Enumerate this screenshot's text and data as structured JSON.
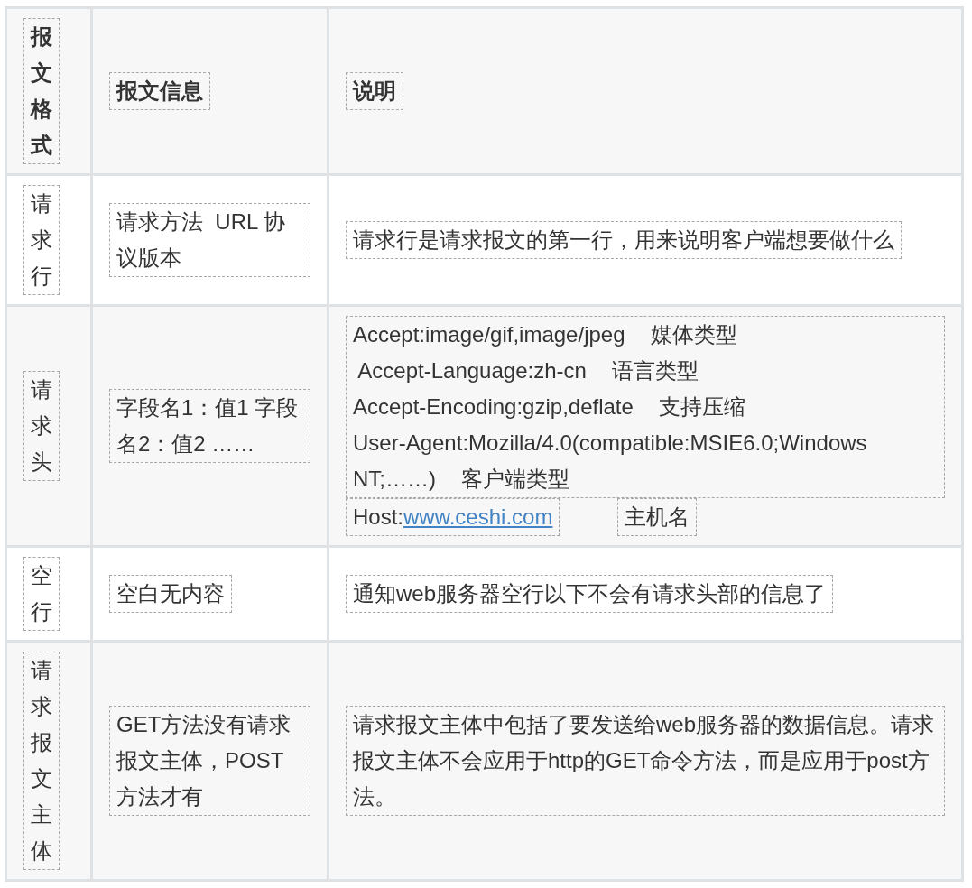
{
  "table": {
    "columns": [
      {
        "text": "报文格式",
        "vertical": true
      },
      {
        "text": "报文信息",
        "vertical": false
      },
      {
        "text": "说明",
        "vertical": false
      }
    ],
    "rows": [
      {
        "label": "请求行",
        "info": "请求方法  URL 协议版本",
        "description": {
          "kind": "text",
          "text": "请求行是请求报文的第一行，用来说明客户端想要做什么"
        }
      },
      {
        "label": "请求头",
        "info": "字段名1：值1 字段名2：值2 ……",
        "description": {
          "kind": "headers",
          "lines": [
            {
              "field": "Accept:image/gif,image/jpeg",
              "note": "媒体类型"
            },
            {
              "field": " Accept-Language:zh-cn",
              "note": "语言类型"
            },
            {
              "field": "Accept-Encoding:gzip,deflate",
              "note": "支持压缩"
            },
            {
              "field": "User-Agent:Mozilla/4.0(compatible:MSIE6.0;Windows"
            },
            {
              "field": "NT;……)",
              "note": "客户端类型"
            }
          ],
          "host": {
            "prefix": "Host:",
            "link": "www.ceshi.com"
          },
          "host_note": "主机名"
        }
      },
      {
        "label": "空行",
        "info": "空白无内容",
        "description": {
          "kind": "text",
          "text": "通知web服务器空行以下不会有请求头部的信息了"
        }
      },
      {
        "label": "请求报文主体",
        "info": "GET方法没有请求报文主体，POST方法才有",
        "description": {
          "kind": "text",
          "text": "请求报文主体中包括了要发送给web服务器的数据信息。请求报文主体不会应用于http的GET命令方法，而是应用于post方法。"
        }
      }
    ]
  }
}
